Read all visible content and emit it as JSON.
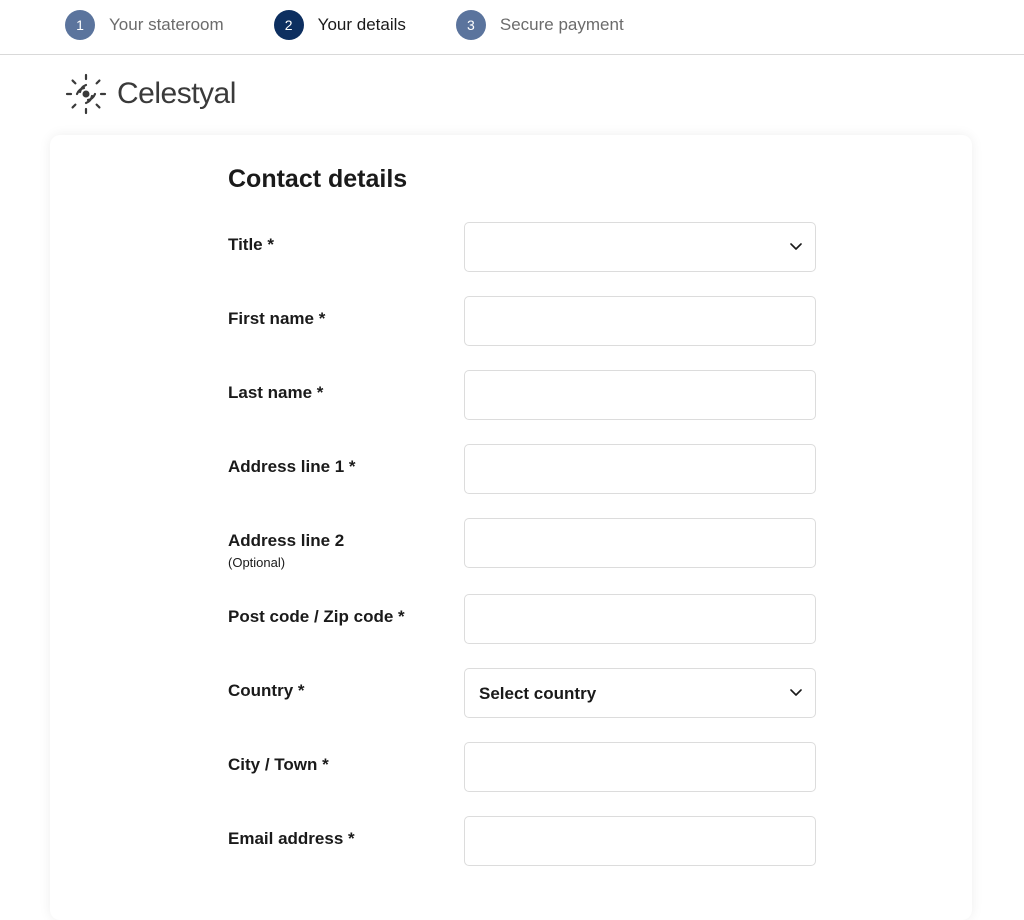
{
  "progress": {
    "steps": [
      {
        "num": "1",
        "label": "Your stateroom",
        "active": false
      },
      {
        "num": "2",
        "label": "Your details",
        "active": true
      },
      {
        "num": "3",
        "label": "Secure payment",
        "active": false
      }
    ]
  },
  "brand": {
    "name": "Celestyal"
  },
  "form": {
    "heading": "Contact details",
    "fields": {
      "title": {
        "label": "Title *",
        "value": "",
        "placeholder": ""
      },
      "first_name": {
        "label": "First name *",
        "value": ""
      },
      "last_name": {
        "label": "Last name *",
        "value": ""
      },
      "address1": {
        "label": "Address line 1 *",
        "value": ""
      },
      "address2": {
        "label": "Address line 2",
        "sublabel": "(Optional)",
        "value": ""
      },
      "postcode": {
        "label": "Post code / Zip code *",
        "value": ""
      },
      "country": {
        "label": "Country *",
        "value": "Select country"
      },
      "city": {
        "label": "City / Town *",
        "value": ""
      },
      "email": {
        "label": "Email address *",
        "value": ""
      }
    }
  }
}
